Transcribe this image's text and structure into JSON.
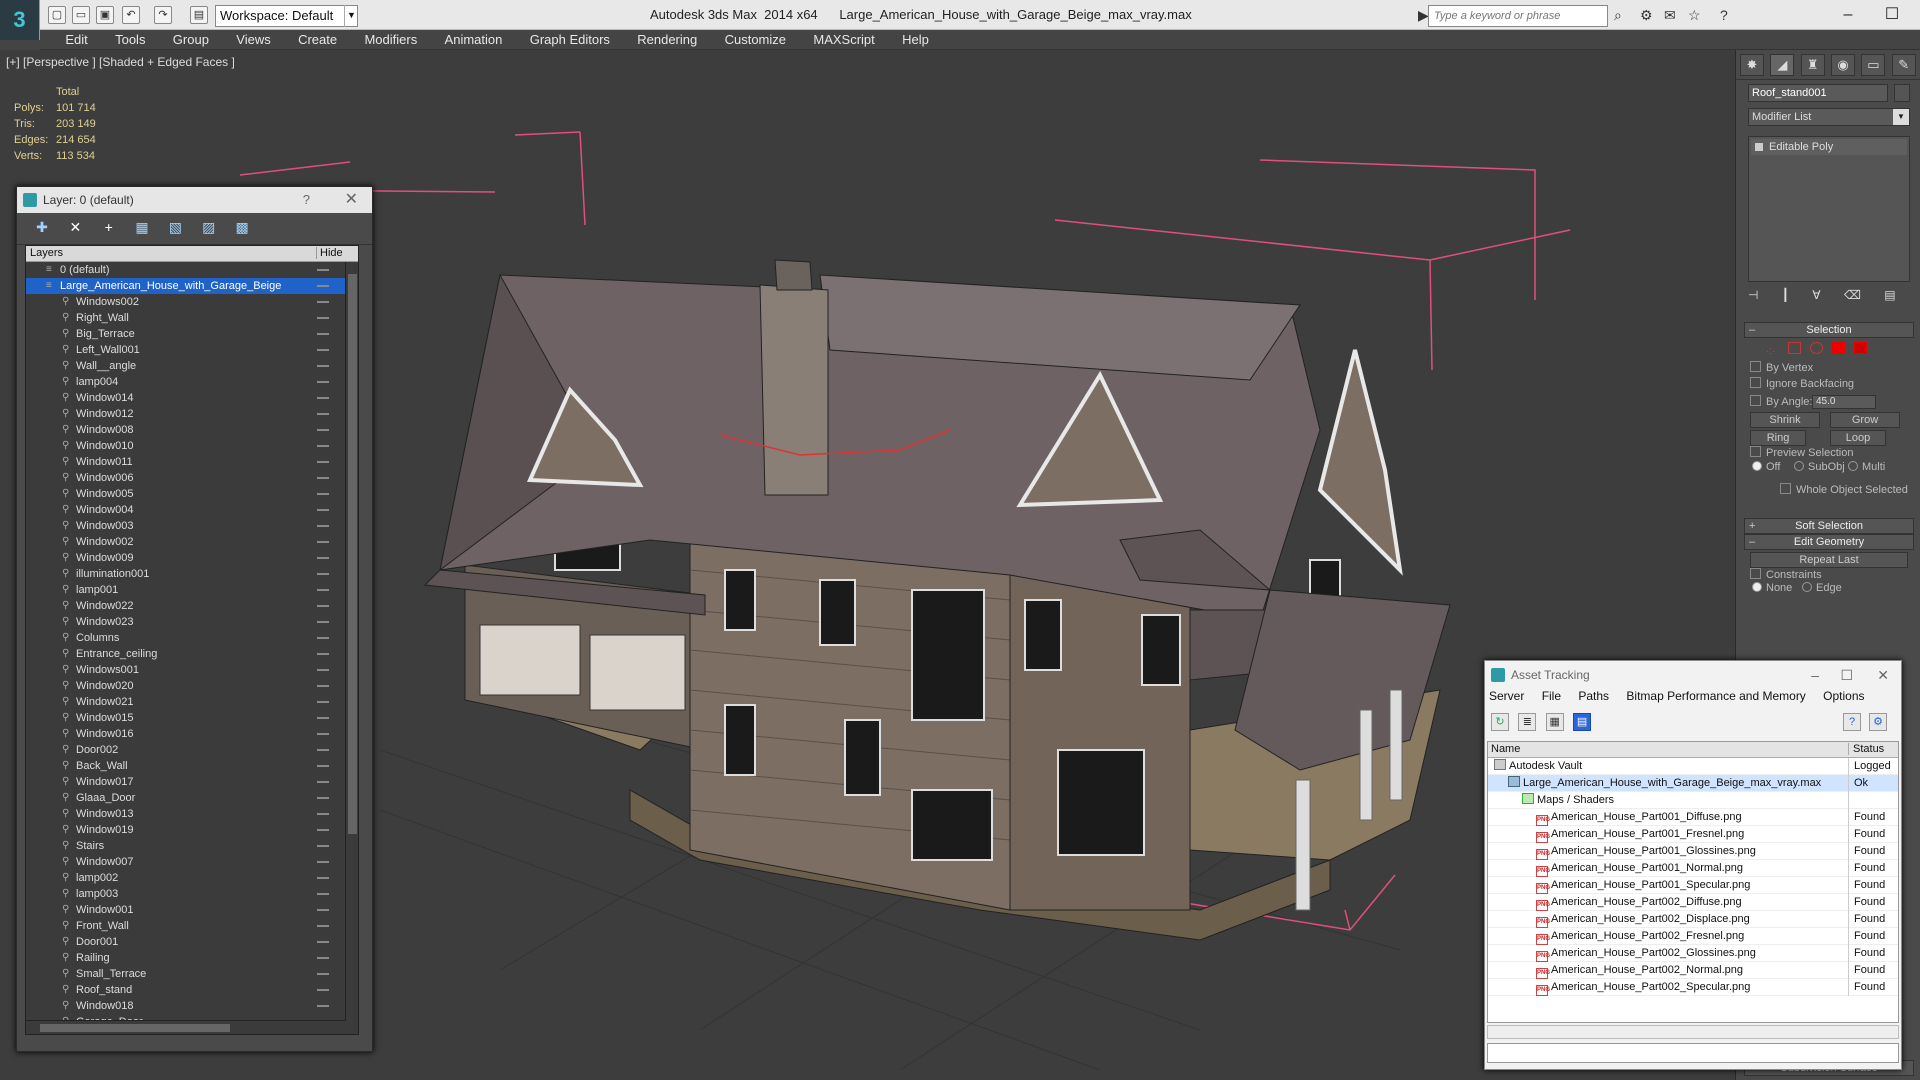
{
  "titlebar": {
    "logo": "3",
    "workspace": "Workspace: Default",
    "title": "Autodesk 3ds Max  2014 x64      Large_American_House_with_Garage_Beige_max_vray.max",
    "search_placeholder": "Type a keyword or phrase"
  },
  "menu": [
    "Edit",
    "Tools",
    "Group",
    "Views",
    "Create",
    "Modifiers",
    "Animation",
    "Graph Editors",
    "Rendering",
    "Customize",
    "MAXScript",
    "Help"
  ],
  "viewport": {
    "label": "[+] [Perspective ] [Shaded + Edged Faces ]",
    "stats": {
      "total_label": "Total",
      "rows": [
        {
          "k": "Polys:",
          "v": "101 714"
        },
        {
          "k": "Tris:",
          "v": "203 149"
        },
        {
          "k": "Edges:",
          "v": "214 654"
        },
        {
          "k": "Verts:",
          "v": "113 534"
        }
      ]
    }
  },
  "layer_panel": {
    "title": "Layer: 0 (default)",
    "help": "?",
    "close": "✕",
    "col_layers": "Layers",
    "col_hide": "Hide",
    "top_layers": [
      "0 (default)",
      "Large_American_House_with_Garage_Beige"
    ],
    "objects": [
      "Windows002",
      "Right_Wall",
      "Big_Terrace",
      "Left_Wall001",
      "Wall__angle",
      "lamp004",
      "Window014",
      "Window012",
      "Window008",
      "Window010",
      "Window011",
      "Window006",
      "Window005",
      "Window004",
      "Window003",
      "Window002",
      "Window009",
      "illumination001",
      "lamp001",
      "Window022",
      "Window023",
      "Columns",
      "Entrance_ceiling",
      "Windows001",
      "Window020",
      "Window021",
      "Window015",
      "Window016",
      "Door002",
      "Back_Wall",
      "Window017",
      "Glaaa_Door",
      "Window013",
      "Window019",
      "Stairs",
      "Window007",
      "lamp002",
      "lamp003",
      "Window001",
      "Front_Wall",
      "Door001",
      "Railing",
      "Small_Terrace",
      "Roof_stand",
      "Window018",
      "Garage_Door"
    ]
  },
  "command_panel": {
    "object_name": "Roof_stand001",
    "modifier_list": "Modifier List",
    "stack_item": "Editable Poly",
    "selection": "Selection",
    "by_vertex": "By Vertex",
    "ignore_backfacing": "Ignore Backfacing",
    "by_angle": "By Angle:",
    "angle_value": "45.0",
    "shrink": "Shrink",
    "grow": "Grow",
    "ring": "Ring",
    "loop": "Loop",
    "preview_selection": "Preview Selection",
    "off": "Off",
    "subobj": "SubObj",
    "multi": "Multi",
    "whole_object": "Whole Object Selected",
    "soft_selection": "Soft Selection",
    "edit_geometry": "Edit Geometry",
    "repeat_last": "Repeat Last",
    "constraints": "Constraints",
    "none": "None",
    "edge": "Edge",
    "subdivision_surface": "Subdivision Surface"
  },
  "asset_tracking": {
    "title": "Asset Tracking",
    "menu": [
      "Server",
      "File",
      "Paths",
      "Bitmap Performance and Memory",
      "Options"
    ],
    "col_name": "Name",
    "col_status": "Status",
    "rows": [
      {
        "name": "Autodesk Vault",
        "status": "Logged",
        "indent": 1,
        "icon": "vault"
      },
      {
        "name": "Large_American_House_with_Garage_Beige_max_vray.max",
        "status": "Ok",
        "indent": 2,
        "icon": "file"
      },
      {
        "name": "Maps / Shaders",
        "status": "",
        "indent": 3,
        "icon": "folder"
      },
      {
        "name": "American_House_Part001_Diffuse.png",
        "status": "Found",
        "indent": 4,
        "icon": "png"
      },
      {
        "name": "American_House_Part001_Fresnel.png",
        "status": "Found",
        "indent": 4,
        "icon": "png"
      },
      {
        "name": "American_House_Part001_Glossines.png",
        "status": "Found",
        "indent": 4,
        "icon": "png"
      },
      {
        "name": "American_House_Part001_Normal.png",
        "status": "Found",
        "indent": 4,
        "icon": "png"
      },
      {
        "name": "American_House_Part001_Specular.png",
        "status": "Found",
        "indent": 4,
        "icon": "png"
      },
      {
        "name": "American_House_Part002_Diffuse.png",
        "status": "Found",
        "indent": 4,
        "icon": "png"
      },
      {
        "name": "American_House_Part002_Displace.png",
        "status": "Found",
        "indent": 4,
        "icon": "png"
      },
      {
        "name": "American_House_Part002_Fresnel.png",
        "status": "Found",
        "indent": 4,
        "icon": "png"
      },
      {
        "name": "American_House_Part002_Glossines.png",
        "status": "Found",
        "indent": 4,
        "icon": "png"
      },
      {
        "name": "American_House_Part002_Normal.png",
        "status": "Found",
        "indent": 4,
        "icon": "png"
      },
      {
        "name": "American_House_Part002_Specular.png",
        "status": "Found",
        "indent": 4,
        "icon": "png"
      }
    ]
  },
  "colors": {
    "accent": "#1f63c9",
    "viewport_bg": "#3d3d3d",
    "bbox": "#e0507a"
  }
}
